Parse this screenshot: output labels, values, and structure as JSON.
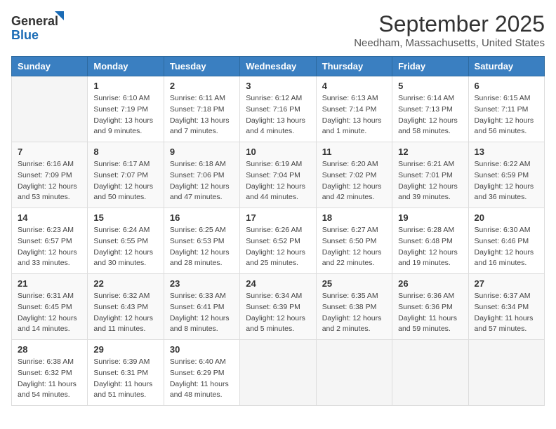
{
  "logo": {
    "text_general": "General",
    "text_blue": "Blue"
  },
  "header": {
    "month_title": "September 2025",
    "location": "Needham, Massachusetts, United States"
  },
  "columns": [
    "Sunday",
    "Monday",
    "Tuesday",
    "Wednesday",
    "Thursday",
    "Friday",
    "Saturday"
  ],
  "weeks": [
    [
      {
        "day": "",
        "sunrise": "",
        "sunset": "",
        "daylight": ""
      },
      {
        "day": "1",
        "sunrise": "Sunrise: 6:10 AM",
        "sunset": "Sunset: 7:19 PM",
        "daylight": "Daylight: 13 hours and 9 minutes."
      },
      {
        "day": "2",
        "sunrise": "Sunrise: 6:11 AM",
        "sunset": "Sunset: 7:18 PM",
        "daylight": "Daylight: 13 hours and 7 minutes."
      },
      {
        "day": "3",
        "sunrise": "Sunrise: 6:12 AM",
        "sunset": "Sunset: 7:16 PM",
        "daylight": "Daylight: 13 hours and 4 minutes."
      },
      {
        "day": "4",
        "sunrise": "Sunrise: 6:13 AM",
        "sunset": "Sunset: 7:14 PM",
        "daylight": "Daylight: 13 hours and 1 minute."
      },
      {
        "day": "5",
        "sunrise": "Sunrise: 6:14 AM",
        "sunset": "Sunset: 7:13 PM",
        "daylight": "Daylight: 12 hours and 58 minutes."
      },
      {
        "day": "6",
        "sunrise": "Sunrise: 6:15 AM",
        "sunset": "Sunset: 7:11 PM",
        "daylight": "Daylight: 12 hours and 56 minutes."
      }
    ],
    [
      {
        "day": "7",
        "sunrise": "Sunrise: 6:16 AM",
        "sunset": "Sunset: 7:09 PM",
        "daylight": "Daylight: 12 hours and 53 minutes."
      },
      {
        "day": "8",
        "sunrise": "Sunrise: 6:17 AM",
        "sunset": "Sunset: 7:07 PM",
        "daylight": "Daylight: 12 hours and 50 minutes."
      },
      {
        "day": "9",
        "sunrise": "Sunrise: 6:18 AM",
        "sunset": "Sunset: 7:06 PM",
        "daylight": "Daylight: 12 hours and 47 minutes."
      },
      {
        "day": "10",
        "sunrise": "Sunrise: 6:19 AM",
        "sunset": "Sunset: 7:04 PM",
        "daylight": "Daylight: 12 hours and 44 minutes."
      },
      {
        "day": "11",
        "sunrise": "Sunrise: 6:20 AM",
        "sunset": "Sunset: 7:02 PM",
        "daylight": "Daylight: 12 hours and 42 minutes."
      },
      {
        "day": "12",
        "sunrise": "Sunrise: 6:21 AM",
        "sunset": "Sunset: 7:01 PM",
        "daylight": "Daylight: 12 hours and 39 minutes."
      },
      {
        "day": "13",
        "sunrise": "Sunrise: 6:22 AM",
        "sunset": "Sunset: 6:59 PM",
        "daylight": "Daylight: 12 hours and 36 minutes."
      }
    ],
    [
      {
        "day": "14",
        "sunrise": "Sunrise: 6:23 AM",
        "sunset": "Sunset: 6:57 PM",
        "daylight": "Daylight: 12 hours and 33 minutes."
      },
      {
        "day": "15",
        "sunrise": "Sunrise: 6:24 AM",
        "sunset": "Sunset: 6:55 PM",
        "daylight": "Daylight: 12 hours and 30 minutes."
      },
      {
        "day": "16",
        "sunrise": "Sunrise: 6:25 AM",
        "sunset": "Sunset: 6:53 PM",
        "daylight": "Daylight: 12 hours and 28 minutes."
      },
      {
        "day": "17",
        "sunrise": "Sunrise: 6:26 AM",
        "sunset": "Sunset: 6:52 PM",
        "daylight": "Daylight: 12 hours and 25 minutes."
      },
      {
        "day": "18",
        "sunrise": "Sunrise: 6:27 AM",
        "sunset": "Sunset: 6:50 PM",
        "daylight": "Daylight: 12 hours and 22 minutes."
      },
      {
        "day": "19",
        "sunrise": "Sunrise: 6:28 AM",
        "sunset": "Sunset: 6:48 PM",
        "daylight": "Daylight: 12 hours and 19 minutes."
      },
      {
        "day": "20",
        "sunrise": "Sunrise: 6:30 AM",
        "sunset": "Sunset: 6:46 PM",
        "daylight": "Daylight: 12 hours and 16 minutes."
      }
    ],
    [
      {
        "day": "21",
        "sunrise": "Sunrise: 6:31 AM",
        "sunset": "Sunset: 6:45 PM",
        "daylight": "Daylight: 12 hours and 14 minutes."
      },
      {
        "day": "22",
        "sunrise": "Sunrise: 6:32 AM",
        "sunset": "Sunset: 6:43 PM",
        "daylight": "Daylight: 12 hours and 11 minutes."
      },
      {
        "day": "23",
        "sunrise": "Sunrise: 6:33 AM",
        "sunset": "Sunset: 6:41 PM",
        "daylight": "Daylight: 12 hours and 8 minutes."
      },
      {
        "day": "24",
        "sunrise": "Sunrise: 6:34 AM",
        "sunset": "Sunset: 6:39 PM",
        "daylight": "Daylight: 12 hours and 5 minutes."
      },
      {
        "day": "25",
        "sunrise": "Sunrise: 6:35 AM",
        "sunset": "Sunset: 6:38 PM",
        "daylight": "Daylight: 12 hours and 2 minutes."
      },
      {
        "day": "26",
        "sunrise": "Sunrise: 6:36 AM",
        "sunset": "Sunset: 6:36 PM",
        "daylight": "Daylight: 11 hours and 59 minutes."
      },
      {
        "day": "27",
        "sunrise": "Sunrise: 6:37 AM",
        "sunset": "Sunset: 6:34 PM",
        "daylight": "Daylight: 11 hours and 57 minutes."
      }
    ],
    [
      {
        "day": "28",
        "sunrise": "Sunrise: 6:38 AM",
        "sunset": "Sunset: 6:32 PM",
        "daylight": "Daylight: 11 hours and 54 minutes."
      },
      {
        "day": "29",
        "sunrise": "Sunrise: 6:39 AM",
        "sunset": "Sunset: 6:31 PM",
        "daylight": "Daylight: 11 hours and 51 minutes."
      },
      {
        "day": "30",
        "sunrise": "Sunrise: 6:40 AM",
        "sunset": "Sunset: 6:29 PM",
        "daylight": "Daylight: 11 hours and 48 minutes."
      },
      {
        "day": "",
        "sunrise": "",
        "sunset": "",
        "daylight": ""
      },
      {
        "day": "",
        "sunrise": "",
        "sunset": "",
        "daylight": ""
      },
      {
        "day": "",
        "sunrise": "",
        "sunset": "",
        "daylight": ""
      },
      {
        "day": "",
        "sunrise": "",
        "sunset": "",
        "daylight": ""
      }
    ]
  ]
}
